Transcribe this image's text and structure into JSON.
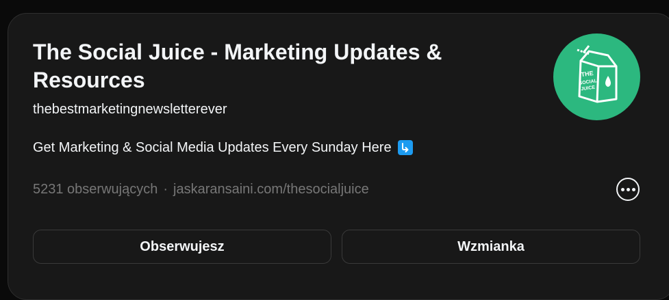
{
  "profile": {
    "title": "The Social Juice - Marketing Updates & Resources",
    "username": "thebestmarketingnewsletterever",
    "bio": "Get Marketing & Social Media Updates Every Sunday Here",
    "bio_emoji": "down-right-arrow-icon",
    "followers": "5231 obserwujących",
    "separator": "·",
    "link": "jaskaransaini.com/thesocialjuice",
    "avatar_text_line1": "THE",
    "avatar_text_line2": "SOCIAL",
    "avatar_text_line3": "JUICE"
  },
  "actions": {
    "follow_label": "Obserwujesz",
    "mention_label": "Wzmianka",
    "more_icon": "more-options-icon"
  },
  "colors": {
    "background": "#181818",
    "page": "#0a0a0a",
    "text": "#f3f5f7",
    "muted": "#777777",
    "avatar": "#2cb87f",
    "emoji": "#1d9bf0"
  }
}
